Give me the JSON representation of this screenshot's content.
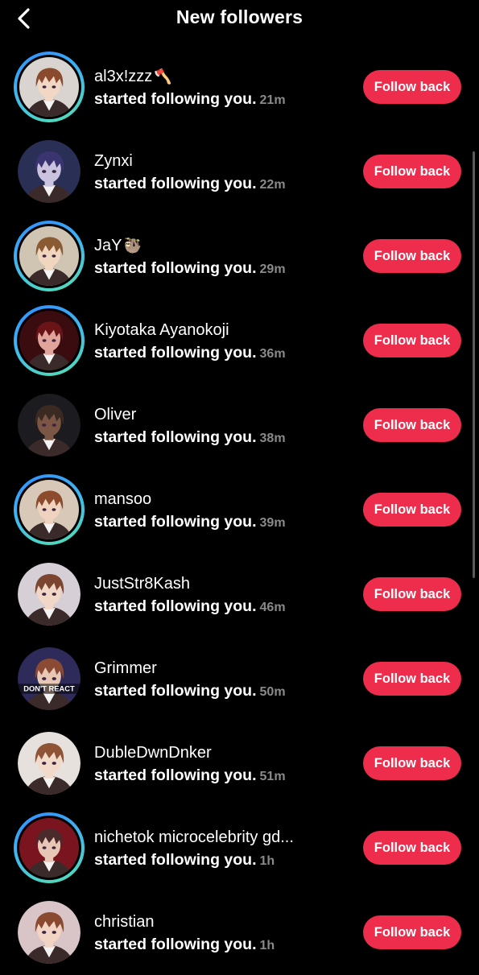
{
  "header": {
    "title": "New followers",
    "back_icon": "chevron-left-icon"
  },
  "follow_label": "Follow back",
  "activity_text": "started following you.",
  "followers": [
    {
      "name": "al3x!zzz",
      "emoji": "🪓",
      "time": "21m",
      "ring": true,
      "avatar_bg": "#d9d4cf",
      "hair": "#8a4a2e",
      "skin": "#f2d8c4"
    },
    {
      "name": "Zynxi",
      "emoji": "",
      "time": "22m",
      "ring": false,
      "avatar_bg": "#2a2f55",
      "hair": "#3a3470",
      "skin": "#c9c3e0"
    },
    {
      "name": "JaY",
      "emoji": "🦥",
      "time": "29m",
      "ring": true,
      "avatar_bg": "#cfc5b2",
      "hair": "#8a5a33",
      "skin": "#f1d6bf"
    },
    {
      "name": "Kiyotaka Ayanokoji",
      "emoji": "",
      "time": "36m",
      "ring": true,
      "avatar_bg": "#3a0c10",
      "hair": "#6a1418",
      "skin": "#e0a49a"
    },
    {
      "name": "Oliver",
      "emoji": "",
      "time": "38m",
      "ring": false,
      "avatar_bg": "#1c1b1f",
      "hair": "#3a2a22",
      "skin": "#7b5645"
    },
    {
      "name": "mansoo",
      "emoji": "",
      "time": "39m",
      "ring": true,
      "avatar_bg": "#d8c8b8",
      "hair": "#8b4b2c",
      "skin": "#f0d3be"
    },
    {
      "name": "JustStr8Kash",
      "emoji": "",
      "time": "46m",
      "ring": false,
      "avatar_bg": "#d7cfd6",
      "hair": "#7b4530",
      "skin": "#f1d7c6"
    },
    {
      "name": "Grimmer",
      "emoji": "",
      "time": "50m",
      "ring": false,
      "avatar_bg": "#2e2a5a",
      "hair": "#8a4a33",
      "skin": "#e8c8b4",
      "overlay_text": "DON'T REACT"
    },
    {
      "name": "DubleDwnDnker",
      "emoji": "",
      "time": "51m",
      "ring": false,
      "avatar_bg": "#e6e1dc",
      "hair": "#8f5436",
      "skin": "#f2dacb"
    },
    {
      "name": "nichetok microcelebrity gd...",
      "emoji": "",
      "time": "1h",
      "ring": true,
      "avatar_bg": "#7a1520",
      "hair": "#4a2a2a",
      "skin": "#e8c6b5"
    },
    {
      "name": "christian",
      "emoji": "",
      "time": "1h",
      "ring": false,
      "avatar_bg": "#d9c4c8",
      "hair": "#8a4a2f",
      "skin": "#f1d4c3"
    }
  ]
}
